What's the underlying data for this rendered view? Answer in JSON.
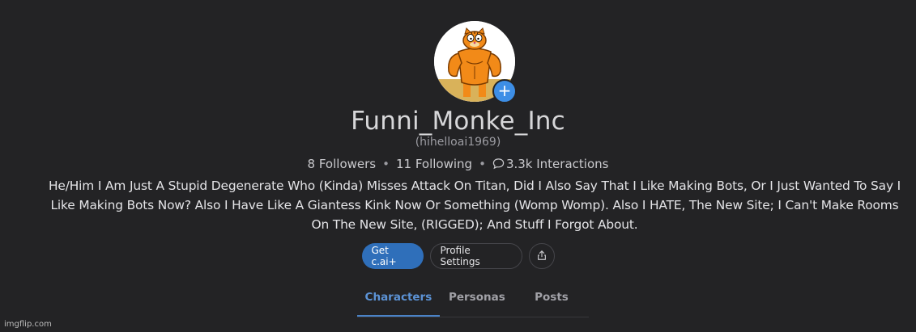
{
  "profile": {
    "display_name": "Funni_Monke_Inc",
    "handle": "(hihelloai1969)",
    "followers": "8 Followers",
    "following": "11 Following",
    "interactions": "3.3k Interactions",
    "bio": "He/Him I Am Just A Stupid Degenerate Who (Kinda) Misses Attack On Titan, Did I Also Say That I Like Making Bots, Or I Just Wanted To Say I Like Making Bots Now? Also I Have Like A Giantess Kink Now Or Something (Womp Womp). Also I HATE, The New Site; I Can't Make Rooms On The New Site, (RIGGED); And Stuff I Forgot About.",
    "separator": "•",
    "add_avatar_glyph": "+"
  },
  "actions": {
    "get_plus_label": "Get c.ai+",
    "profile_settings_label": "Profile Settings",
    "share_icon": "share-icon"
  },
  "tabs": [
    {
      "label": "Characters",
      "active": true
    },
    {
      "label": "Personas",
      "active": false
    },
    {
      "label": "Posts",
      "active": false
    }
  ],
  "watermark": "imgflip.com",
  "colors": {
    "background": "#232325",
    "primary_button": "#2f6fba",
    "active_tab": "#5c93d6",
    "avatar_add": "#3d8ee6"
  }
}
